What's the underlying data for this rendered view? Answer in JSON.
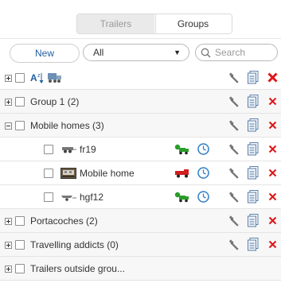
{
  "tabs": [
    {
      "label": "Trailers",
      "active": false
    },
    {
      "label": "Groups",
      "active": true
    }
  ],
  "toolbar": {
    "new_label": "New",
    "filter_value": "All",
    "search_placeholder": "Search"
  },
  "header_row": {
    "sort_icon": "sort-az-icon",
    "trailer_icon": "trailer-icon"
  },
  "groups": [
    {
      "label": "Group 1 (2)",
      "expanded": false
    },
    {
      "label": "Mobile homes (3)",
      "expanded": true,
      "children": [
        {
          "label": "fr19",
          "thumb": "car-trailer-icon",
          "status_color": "#2a9d2a"
        },
        {
          "label": "Mobile home",
          "thumb": "mobile-home-photo-icon",
          "status_color": "#d21f1f"
        },
        {
          "label": "hgf12",
          "thumb": "boat-trailer-icon",
          "status_color": "#2a9d2a"
        }
      ]
    },
    {
      "label": "Portacoches (2)",
      "expanded": false
    },
    {
      "label": "Travelling addicts (0)",
      "expanded": false
    },
    {
      "label": "Trailers outside grou...",
      "expanded": false
    }
  ],
  "colors": {
    "delete": "#e0161a",
    "link": "#1f5fa0",
    "clock": "#2f7ec6"
  }
}
